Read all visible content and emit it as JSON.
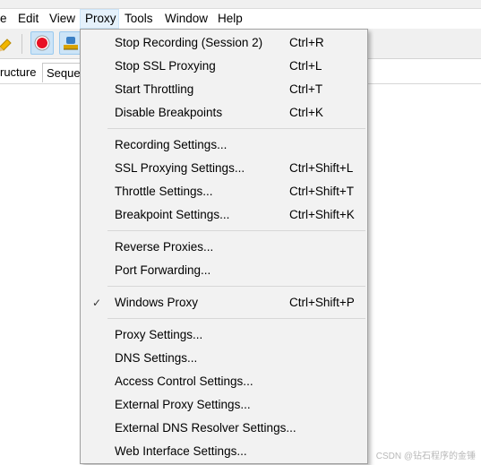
{
  "menubar": {
    "items": [
      {
        "label": "e"
      },
      {
        "label": "Edit"
      },
      {
        "label": "View"
      },
      {
        "label": "Proxy"
      },
      {
        "label": "Tools"
      },
      {
        "label": "Window"
      },
      {
        "label": "Help"
      }
    ]
  },
  "toolbar": {
    "buttons": [
      {
        "icon": "pen-icon"
      },
      {
        "icon": "record-icon",
        "color": "#e81123",
        "pressed": true
      },
      {
        "icon": "throttle-icon",
        "pressed": true
      }
    ]
  },
  "tabs": [
    {
      "label": "ructure"
    },
    {
      "label": "Seque"
    }
  ],
  "proxy_menu": {
    "groups": [
      [
        {
          "label": "Stop Recording (Session 2)",
          "shortcut": "Ctrl+R"
        },
        {
          "label": "Stop SSL Proxying",
          "shortcut": "Ctrl+L"
        },
        {
          "label": "Start Throttling",
          "shortcut": "Ctrl+T"
        },
        {
          "label": "Disable Breakpoints",
          "shortcut": "Ctrl+K"
        }
      ],
      [
        {
          "label": "Recording Settings...",
          "shortcut": ""
        },
        {
          "label": "SSL Proxying Settings...",
          "shortcut": "Ctrl+Shift+L"
        },
        {
          "label": "Throttle Settings...",
          "shortcut": "Ctrl+Shift+T"
        },
        {
          "label": "Breakpoint Settings...",
          "shortcut": "Ctrl+Shift+K"
        }
      ],
      [
        {
          "label": "Reverse Proxies...",
          "shortcut": ""
        },
        {
          "label": "Port Forwarding...",
          "shortcut": ""
        }
      ],
      [
        {
          "label": "Windows Proxy",
          "shortcut": "Ctrl+Shift+P",
          "checked": true,
          "check_mark": "✓"
        }
      ],
      [
        {
          "label": "Proxy Settings...",
          "shortcut": ""
        },
        {
          "label": "DNS Settings...",
          "shortcut": ""
        },
        {
          "label": "Access Control Settings...",
          "shortcut": ""
        },
        {
          "label": "External Proxy Settings...",
          "shortcut": ""
        },
        {
          "label": "External DNS Resolver Settings...",
          "shortcut": ""
        },
        {
          "label": "Web Interface Settings...",
          "shortcut": ""
        }
      ]
    ]
  },
  "watermark": "CSDN @钻石程序的金锤"
}
